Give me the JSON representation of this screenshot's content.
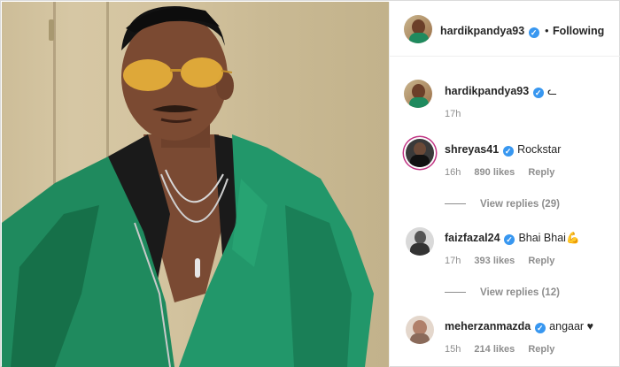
{
  "header": {
    "username": "hardikpandya93",
    "verified_icon": "verified-badge",
    "separator": "•",
    "follow_status": "Following"
  },
  "caption": {
    "username": "hardikpandya93",
    "text": "ᓚ",
    "time": "17h"
  },
  "comments": [
    {
      "username": "shreyas41",
      "text": "Rockstar",
      "time": "16h",
      "likes": "890 likes",
      "reply": "Reply",
      "view_replies": "View replies (29)"
    },
    {
      "username": "faizfazal24",
      "text": "Bhai Bhai💪",
      "time": "17h",
      "likes": "393 likes",
      "reply": "Reply",
      "view_replies": "View replies (12)"
    },
    {
      "username": "meherzanmazda",
      "text": "angaar ♥",
      "time": "15h",
      "likes": "214 likes",
      "reply": "Reply"
    }
  ],
  "colors": {
    "verified": "#3897f0",
    "jacket": "#1f8a5e",
    "text": "#262626",
    "muted": "#8e8e8e"
  }
}
